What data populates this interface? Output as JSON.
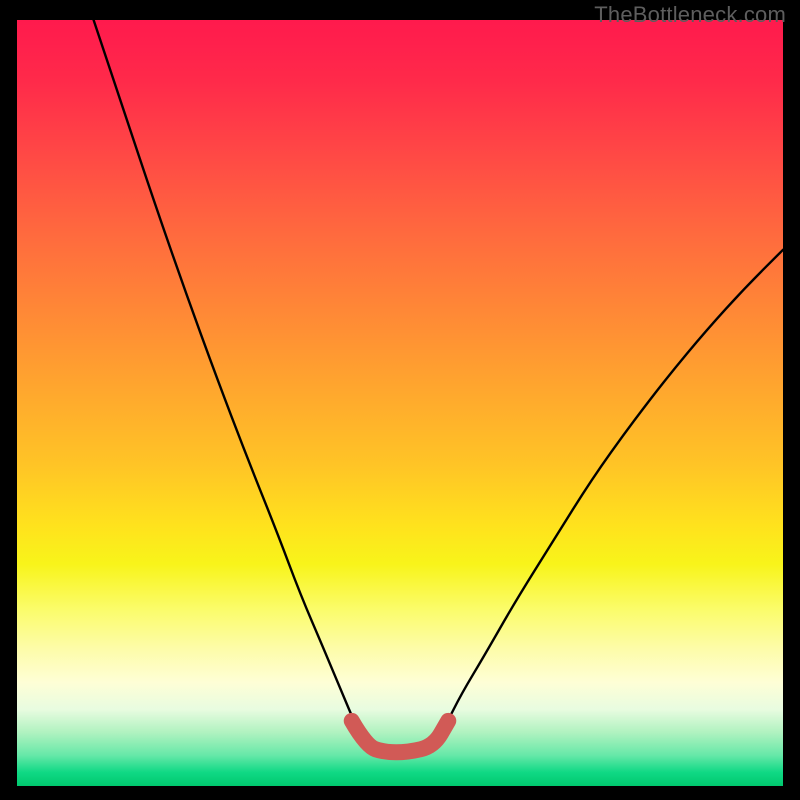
{
  "watermark": "TheBottleneck.com",
  "chart_data": {
    "type": "line",
    "title": "",
    "xlabel": "",
    "ylabel": "",
    "xlim": [
      0,
      100
    ],
    "ylim": [
      0,
      100
    ],
    "series": [
      {
        "name": "black-v-curve",
        "color": "#000000",
        "x": [
          10,
          14,
          18,
          22,
          26,
          30,
          34,
          37,
          40,
          42.5,
          44.2,
          45.6,
          54.4,
          56,
          58,
          61,
          65,
          70,
          75,
          80,
          85,
          90,
          95,
          100
        ],
        "y": [
          100,
          88,
          76,
          64.5,
          53.5,
          43,
          33,
          25,
          18,
          12,
          8,
          5.2,
          5.2,
          8,
          12,
          17,
          24,
          32,
          40,
          47,
          53.5,
          59.5,
          65,
          70
        ]
      },
      {
        "name": "red-flat-thick",
        "color": "#d15a56",
        "x": [
          43.7,
          45.6,
          48,
          51,
          54.4,
          56.3
        ],
        "y": [
          8.5,
          5.2,
          4.4,
          4.4,
          5.2,
          8.5
        ]
      }
    ]
  }
}
